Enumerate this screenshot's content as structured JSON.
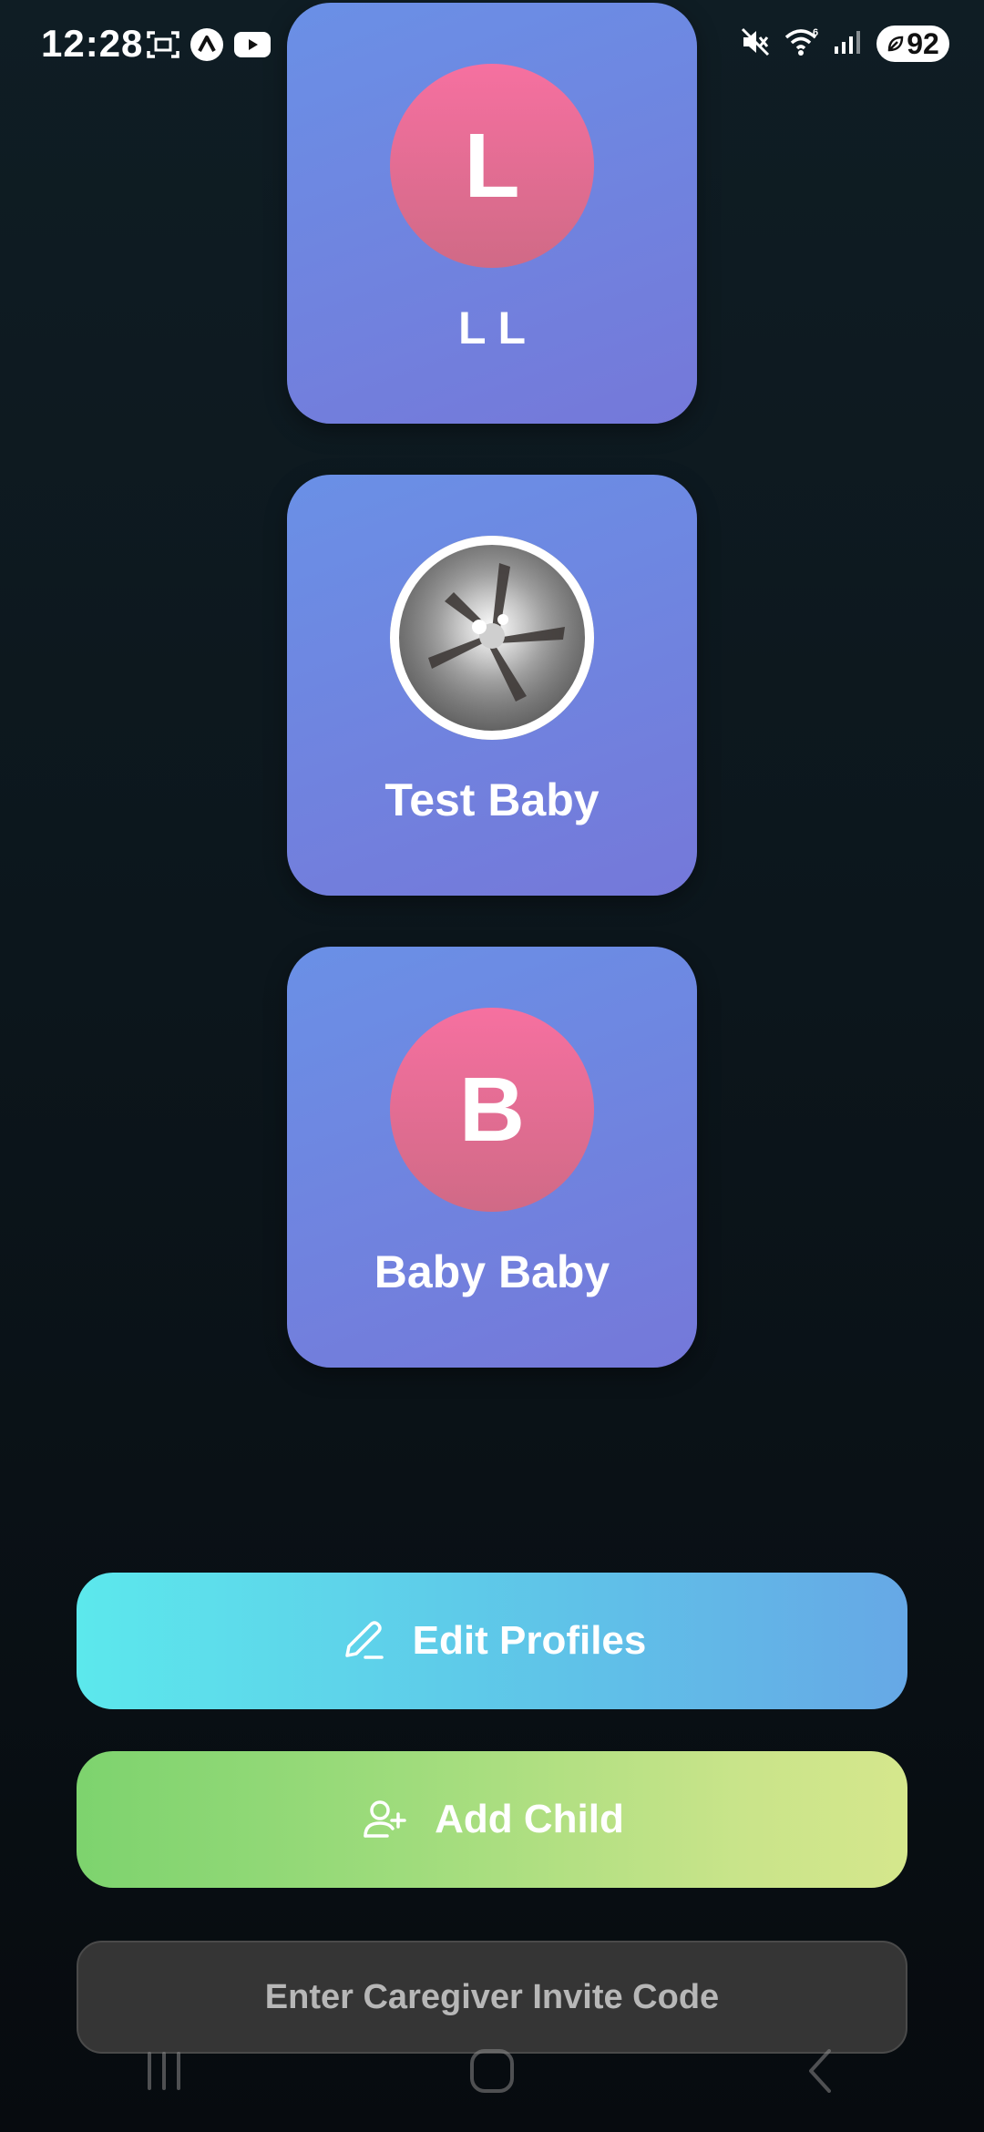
{
  "status_bar": {
    "time": "12:28",
    "battery": "92",
    "icons": [
      "screenshot-icon",
      "app-logo-icon",
      "youtube-icon",
      "mute-icon",
      "wifi-icon",
      "signal-icon",
      "battery-icon"
    ]
  },
  "profiles": [
    {
      "initial": "L",
      "name": "L L",
      "avatar": "initial"
    },
    {
      "initial": "",
      "name": "Test Baby",
      "avatar": "photo"
    },
    {
      "initial": "B",
      "name": "Baby Baby",
      "avatar": "initial"
    }
  ],
  "actions": {
    "edit_label": "Edit Profiles",
    "add_label": "Add Child",
    "invite_label": "Enter Caregiver Invite Code"
  },
  "colors": {
    "card": "#6a90e6",
    "avatar_pink": "#f670a0",
    "edit_button": "#5ce8ec",
    "add_button": "#7dd36e",
    "invite_button": "#353535"
  },
  "nav": {
    "icons": [
      "recent-apps-icon",
      "home-icon",
      "back-icon"
    ]
  }
}
